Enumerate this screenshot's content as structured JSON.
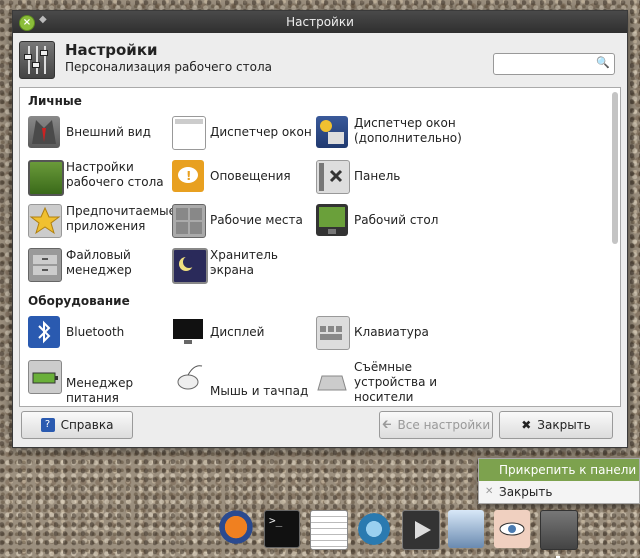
{
  "window": {
    "title": "Настройки",
    "header_title": "Настройки",
    "header_subtitle": "Персонализация рабочего стола",
    "search_placeholder": ""
  },
  "sections": [
    {
      "title": "Личные"
    },
    {
      "title": "Оборудование"
    }
  ],
  "items": [
    {
      "label": "Внешний вид",
      "icon": "appearance-icon"
    },
    {
      "label": "Диспетчер окон",
      "icon": "window-manager-icon"
    },
    {
      "label": "Диспетчер окон (дополнительно)",
      "icon": "window-manager-tweaks-icon"
    },
    {
      "label": "Настройки рабочего стола",
      "icon": "desktop-settings-icon"
    },
    {
      "label": "Оповещения",
      "icon": "notifications-icon"
    },
    {
      "label": "Панель",
      "icon": "panel-icon"
    },
    {
      "label": "Предпочитаемые приложения",
      "icon": "preferred-apps-icon"
    },
    {
      "label": "Рабочие места",
      "icon": "workspaces-icon"
    },
    {
      "label": "Рабочий стол",
      "icon": "desktop-icon"
    },
    {
      "label": "Файловый менеджер",
      "icon": "file-manager-icon"
    },
    {
      "label": "Хранитель экрана",
      "icon": "screensaver-icon"
    },
    {
      "label": "Bluetooth",
      "icon": "bluetooth-icon"
    },
    {
      "label": "Дисплей",
      "icon": "display-icon"
    },
    {
      "label": "Клавиатура",
      "icon": "keyboard-icon"
    },
    {
      "label": "Менеджер питания",
      "icon": "power-manager-icon"
    },
    {
      "label": "Мышь и тачпад",
      "icon": "mouse-touchpad-icon"
    },
    {
      "label": "Съёмные устройства и носители",
      "icon": "removable-drives-icon"
    }
  ],
  "buttons": {
    "help": "Справка",
    "all_settings": "Все настройки",
    "close": "Закрыть"
  },
  "context_menu": {
    "pin": "Прикрепить к панели",
    "close": "Закрыть"
  },
  "dock": [
    "firefox-icon",
    "terminal-icon",
    "text-editor-icon",
    "installer-icon",
    "media-player-icon",
    "mail-icon",
    "eye-icon",
    "settings-icon"
  ],
  "colors": {
    "accent": "#7da24e",
    "titlebar": "#3a3a3a"
  }
}
